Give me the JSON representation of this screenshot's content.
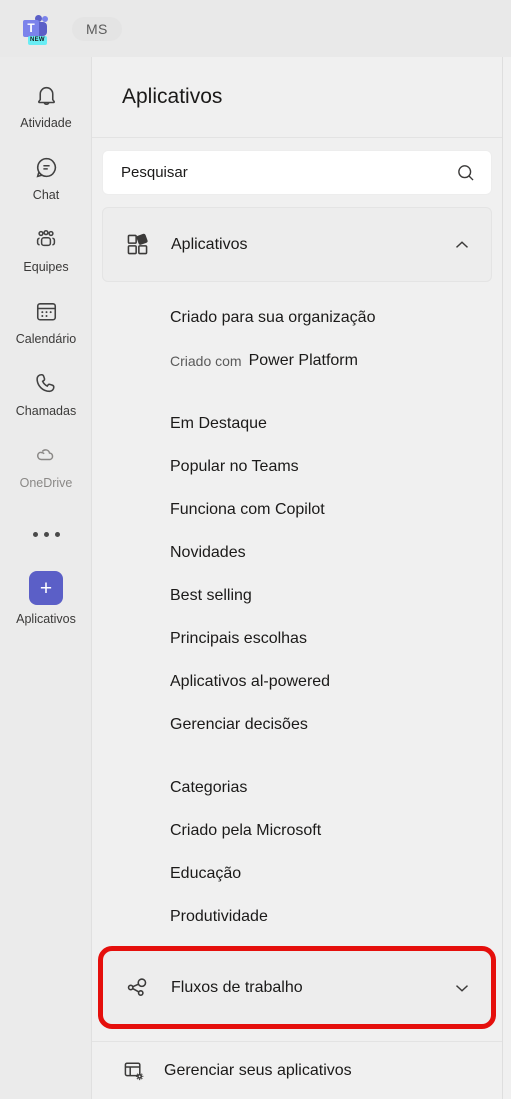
{
  "topbar": {
    "logo_icon": "teams-logo-icon",
    "logo_badge": "NEW",
    "account_initials": "MS"
  },
  "rail": {
    "items": [
      {
        "label": "Atividade",
        "icon": "bell-icon",
        "state": "normal"
      },
      {
        "label": "Chat",
        "icon": "chat-icon",
        "state": "normal"
      },
      {
        "label": "Equipes",
        "icon": "people-icon",
        "state": "normal"
      },
      {
        "label": "Calendário",
        "icon": "calendar-icon",
        "state": "normal"
      },
      {
        "label": "Chamadas",
        "icon": "phone-icon",
        "state": "normal"
      },
      {
        "label": "OneDrive",
        "icon": "cloud-icon",
        "state": "muted"
      }
    ],
    "more_icon": "more-ellipsis-icon",
    "apps": {
      "label": "Aplicativos",
      "icon": "plus-icon",
      "tile_color": "#5B5FC7"
    }
  },
  "panel": {
    "title": "Aplicativos",
    "search": {
      "placeholder": "Pesquisar",
      "value": "",
      "icon": "search-icon"
    },
    "sections": [
      {
        "label": "Aplicativos",
        "icon": "apps-grid-icon",
        "chevron": "chevron-up-icon",
        "expanded": true,
        "highlighted": false
      },
      {
        "label": "Fluxos de trabalho",
        "icon": "workflow-share-icon",
        "chevron": "chevron-down-icon",
        "expanded": false,
        "highlighted": true
      }
    ],
    "menu": [
      {
        "label": "Criado para sua organização"
      },
      {
        "lead": "Criado com",
        "label": "Power Platform"
      },
      {
        "gap": true
      },
      {
        "label": "Em Destaque"
      },
      {
        "label": "Popular no Teams"
      },
      {
        "label": "Funciona com Copilot"
      },
      {
        "label": "Novidades"
      },
      {
        "label": "Best selling"
      },
      {
        "label": "Principais escolhas"
      },
      {
        "label": "Aplicativos al-powered"
      },
      {
        "label": "Gerenciar decisões"
      },
      {
        "gap": true
      },
      {
        "label": "Categorias"
      },
      {
        "label": "Criado pela Microsoft"
      },
      {
        "label": "Educação"
      },
      {
        "label": "Produtividade"
      }
    ],
    "bottom": {
      "label": "Gerenciar seus aplicativos",
      "icon": "manage-apps-gear-icon"
    }
  },
  "colors": {
    "highlight_red": "#E50F0C",
    "teams_purple": "#5B5FC7",
    "panel_bg": "#F0F0F0",
    "rail_bg": "#EBEBEB"
  }
}
